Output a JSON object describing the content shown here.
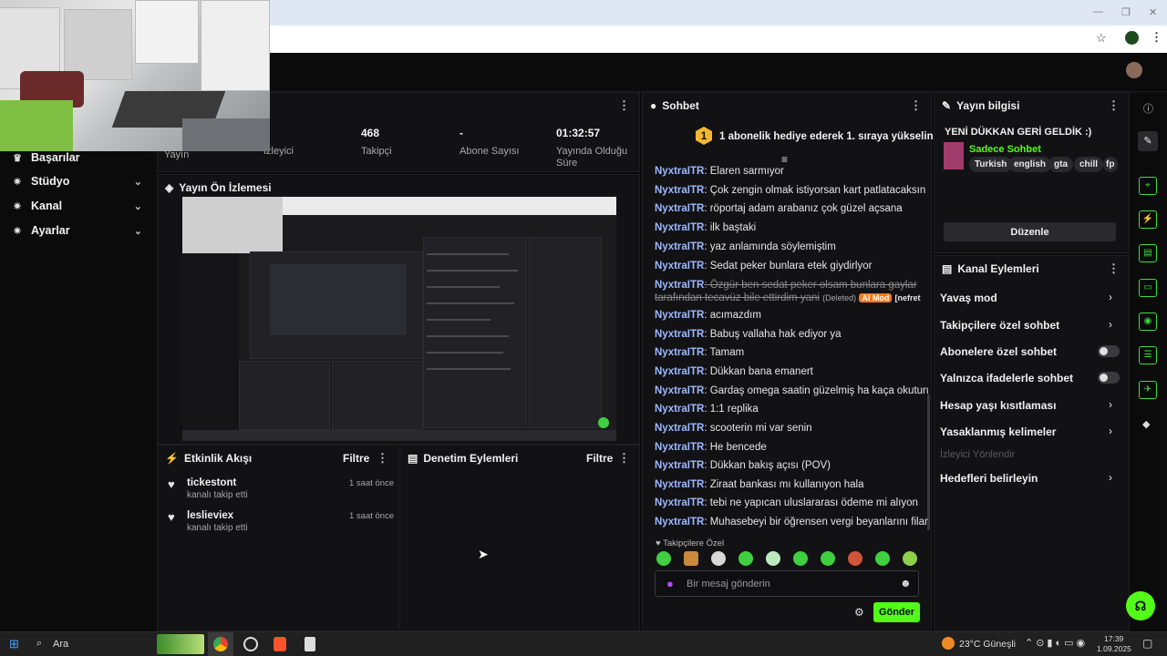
{
  "nav": {
    "items": [
      {
        "label": "Başarılar",
        "icon": "trophy-icon"
      },
      {
        "label": "Stüdyo",
        "icon": "gear-icon"
      },
      {
        "label": "Kanal",
        "icon": "gear-icon"
      },
      {
        "label": "Ayarlar",
        "icon": "gear-icon"
      }
    ]
  },
  "stats": [
    {
      "value": "",
      "label": "Yayın"
    },
    {
      "value": "",
      "label": "İzleyici"
    },
    {
      "value": "468",
      "label": "Takipçi"
    },
    {
      "value": "-",
      "label": "Abone Sayısı"
    },
    {
      "value": "01:32:57",
      "label": "Yayında Olduğu Süre"
    }
  ],
  "preview": {
    "title": "Yayın Ön İzlemesi"
  },
  "activity": {
    "title": "Etkinlik Akışı",
    "filter": "Filtre",
    "items": [
      {
        "name": "tickestont",
        "sub": "kanalı takip etti",
        "time": "1 saat önce"
      },
      {
        "name": "leslieviex",
        "sub": "kanalı takip etti",
        "time": "1 saat önce"
      }
    ]
  },
  "moderation": {
    "title": "Denetim Eylemleri",
    "filter": "Filtre"
  },
  "chat": {
    "title": "Sohbet",
    "pinned_badge": "1",
    "pinned_text": "1 abonelik hediye ederek 1. sıraya yükselin",
    "messages": [
      {
        "user": "NyxtraITR",
        "text": "Elaren sarmıyor"
      },
      {
        "user": "NyxtraITR",
        "text": "Çok zengin olmak istiyorsan kart patlatacaksın"
      },
      {
        "user": "NyxtraITR",
        "text": "röportaj adam arabanız çok güzel açsana"
      },
      {
        "user": "NyxtraITR",
        "text": "ilk baştaki"
      },
      {
        "user": "NyxtraITR",
        "text": "yaz anlamında söylemiştim"
      },
      {
        "user": "NyxtraITR",
        "text": "Sedat peker bunlara etek giydirlyor"
      },
      {
        "user": "NyxtraITR",
        "text": "acımazdım"
      },
      {
        "user": "NyxtraITR",
        "text": "Babuş vallaha hak ediyor ya"
      },
      {
        "user": "NyxtraITR",
        "text": "Tamam"
      },
      {
        "user": "NyxtraITR",
        "text": "Dükkan bana emanert"
      },
      {
        "user": "NyxtraITR",
        "text": "Gardaş omega saatin güzelmiş ha kaça okuturuz"
      },
      {
        "user": "NyxtraITR",
        "text": "1:1 replika"
      },
      {
        "user": "NyxtraITR",
        "text": "scooterin mi var senin"
      },
      {
        "user": "NyxtraITR",
        "text": "He bencede"
      },
      {
        "user": "NyxtraITR",
        "text": "Dükkan bakış açısı (POV)"
      },
      {
        "user": "NyxtraITR",
        "text": "Ziraat bankası mı kullanıyon hala"
      },
      {
        "user": "NyxtraITR",
        "text": "tebi ne yapıcan uluslararası ödeme mi alıyon"
      },
      {
        "user": "NyxtraITR",
        "text": "Muhasebeyi bir öğrensen vergi beyanlarını filan"
      }
    ],
    "deleted": {
      "user": "NyxtraITR",
      "text_line1": "Özgür ben sedat peker olsam bunlara gaylar tarafından",
      "text_line2": "tecavüz bile ettirdim yani",
      "deleted_label": "(Deleted)",
      "ai_badge": "AI Mod",
      "reason": "[nefret söylemleri]"
    },
    "followers_only": "Takipçilere Özel",
    "input_placeholder": "Bir mesaj gönderin",
    "send_label": "Gönder"
  },
  "stream_info": {
    "title": "Yayın bilgisi",
    "stream_title": "YENİ DÜKKAN GERİ GELDİK :)",
    "category": "Sadece Sohbet",
    "tags": [
      "Turkish",
      "english",
      "gta",
      "chill",
      "fp"
    ],
    "edit_label": "Düzenle"
  },
  "channel_actions": {
    "title": "Kanal Eylemleri",
    "items": [
      {
        "label": "Yavaş mod",
        "control": "chevron"
      },
      {
        "label": "Takipçilere özel sohbet",
        "control": "chevron"
      },
      {
        "label": "Abonelere özel sohbet",
        "control": "toggle"
      },
      {
        "label": "Yalnızca ifadelerle sohbet",
        "control": "toggle"
      },
      {
        "label": "Hesap yaşı kısıtlaması",
        "control": "chevron"
      },
      {
        "label": "Yasaklanmış kelimeler",
        "control": "chevron"
      },
      {
        "label": "İzleyici Yönlendir",
        "control": "none"
      },
      {
        "label": "Hedefleri belirleyin",
        "control": "chevron"
      }
    ]
  },
  "taskbar": {
    "search": "Ara",
    "weather": "23°C Güneşli",
    "time": "17:39",
    "date": "1.09.2025"
  },
  "colors": {
    "accent": "#53fc18",
    "panel": "#121214",
    "bg": "#0b0b0c",
    "user": "#9cb8ff",
    "gold": "#f5b731"
  }
}
